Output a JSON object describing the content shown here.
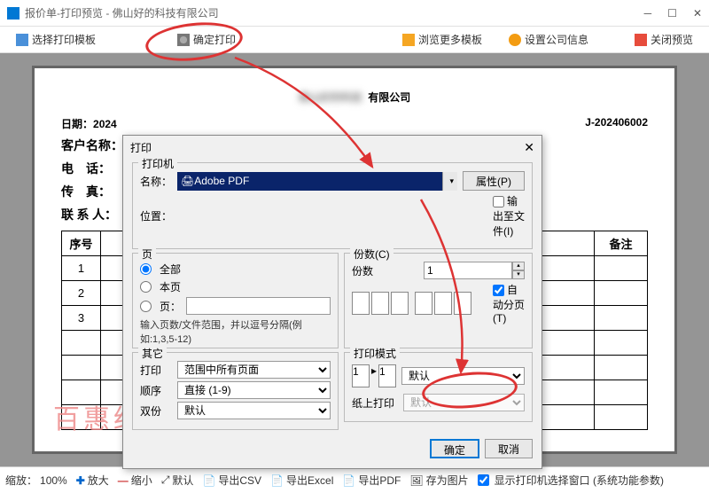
{
  "window": {
    "title": "报价单-打印预览 - 佛山好的科技有限公司"
  },
  "toolbar": {
    "selectTemplate": "选择打印模板",
    "confirmPrint": "确定打印",
    "moreTemplates": "浏览更多模板",
    "companyInfo": "设置公司信息",
    "closePreview": "关闭预览"
  },
  "document": {
    "companySuffix": "有限公司",
    "dateLabel": "日期：",
    "dateValue": "2024",
    "billNo": "J-202406002",
    "customerLabel": "客户名称：",
    "phoneLabel": "电　话：",
    "faxLabel": "传　真：",
    "contactLabel": "联 系 人：",
    "tableHeaders": {
      "no": "序号",
      "remark": "备注"
    },
    "rows": [
      "1",
      "2",
      "3"
    ]
  },
  "dialog": {
    "title": "打印",
    "printerGroup": "打印机",
    "nameLabel": "名称：",
    "printerName": "Adobe PDF",
    "locationLabel": "位置：",
    "propsBtn": "属性(P)",
    "outputToFile": "输出至文件(I)",
    "pageGroup": "页",
    "optAll": "全部",
    "optCurrent": "本页",
    "optPages": "页：",
    "pagesHint": "输入页数/文件范围，并以逗号分隔(例如:1,3,5-12)",
    "otherGroup": "其它",
    "printLabel": "打印",
    "printRange": "范围中所有页面",
    "orderLabel": "顺序",
    "orderValue": "直接 (1-9)",
    "dupLabel": "双份",
    "dupValue": "默认",
    "copiesGroup": "份数(C)",
    "copiesLabel": "份数",
    "copiesValue": "1",
    "collate": "自动分页(T)",
    "modeGroup": "打印模式",
    "modeValue": "默认",
    "paperLabel": "纸上打印",
    "paperValue": "默认",
    "ok": "确定",
    "cancel": "取消"
  },
  "watermark": "百惠经营管理系统通用版",
  "statusbar": {
    "zoomLabel": "缩放：",
    "zoomValue": "100%",
    "zoomIn": "放大",
    "zoomOut": "缩小",
    "default": "默认",
    "exportCsv": "导出CSV",
    "exportExcel": "导出Excel",
    "exportPdf": "导出PDF",
    "saveImg": "存为图片",
    "showPrinterSel": "显示打印机选择窗口 (系统功能参数)"
  }
}
